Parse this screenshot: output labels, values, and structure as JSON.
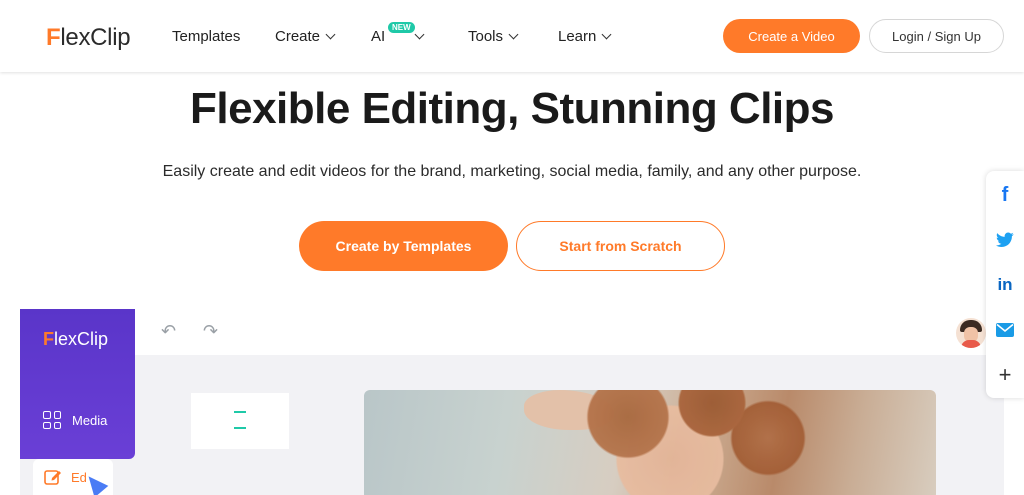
{
  "nav": {
    "logo_f": "F",
    "logo_rest": "lexClip",
    "items": [
      {
        "label": "Templates"
      },
      {
        "label": "Create"
      },
      {
        "label": "AI"
      },
      {
        "label": "Tools"
      },
      {
        "label": "Learn"
      }
    ],
    "ai_badge": "NEW",
    "create_video_label": "Create a Video",
    "login_label": "Login / Sign Up"
  },
  "hero": {
    "title": "Flexible Editing, Stunning Clips",
    "subtitle": "Easily create and edit videos for the brand, marketing, social media, family, and any other purpose.",
    "cta_primary": "Create by Templates",
    "cta_secondary": "Start from Scratch"
  },
  "social": {
    "items": [
      {
        "icon": "facebook-icon",
        "glyph": "f",
        "color": "#1877f2"
      },
      {
        "icon": "twitter-icon",
        "glyph": "🐦",
        "color": "#1da1f2"
      },
      {
        "icon": "linkedin-icon",
        "glyph": "in",
        "color": "#0a66c2"
      },
      {
        "icon": "email-icon",
        "glyph": "✉",
        "color": "#1a9be6"
      },
      {
        "icon": "plus-icon",
        "glyph": "+",
        "color": "#333333"
      }
    ]
  },
  "editor": {
    "logo_f": "F",
    "logo_rest": "lexClip",
    "media_label": "Media",
    "edit_label": "Ed",
    "undo_glyph": "↶",
    "redo_glyph": "↷"
  },
  "colors": {
    "accent": "#ff7a29",
    "editor_sidebar": "#5a35c9",
    "badge": "#1fc9a8"
  }
}
